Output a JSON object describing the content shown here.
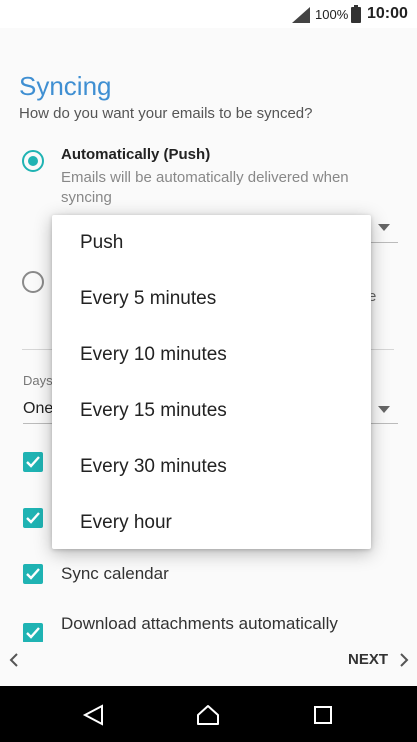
{
  "status_bar": {
    "battery_percent": "100%",
    "time": "10:00"
  },
  "page": {
    "title": "Syncing",
    "subtitle": "How do you want your emails to be synced?"
  },
  "options": {
    "push_title": "Automatically (Push)",
    "push_desc": "Emails will be automatically delivered when syncing",
    "push_selected": true,
    "manual_selected": false,
    "partial_trailing_char": "e"
  },
  "days": {
    "label": "Days",
    "value": "One"
  },
  "checkboxes": [
    {
      "label": "",
      "checked": true
    },
    {
      "label": "",
      "checked": true
    },
    {
      "label": "Sync calendar",
      "checked": true
    },
    {
      "label": "Download attachments automatically",
      "checked": true
    }
  ],
  "popup": {
    "items": [
      "Push",
      "Every 5 minutes",
      "Every 10 minutes",
      "Every 15 minutes",
      "Every 30 minutes",
      "Every hour"
    ]
  },
  "bottom": {
    "next_label": "NEXT"
  },
  "colors": {
    "accent": "#1fb3b3",
    "title": "#3f8fd2"
  },
  "icons": {
    "signal": "signal-icon",
    "battery": "battery-icon",
    "back": "chevron-left-icon",
    "next": "chevron-right-icon",
    "nav_back": "nav-back-icon",
    "nav_home": "nav-home-icon",
    "nav_recent": "nav-recent-icon"
  }
}
